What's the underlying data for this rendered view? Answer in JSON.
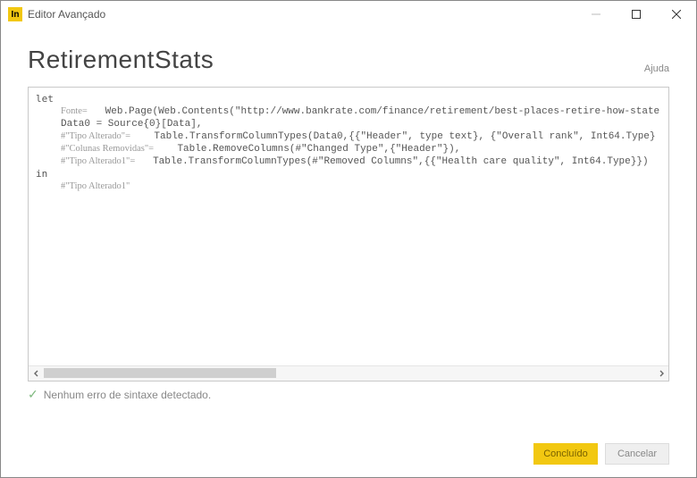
{
  "window": {
    "title": "Editor Avançado",
    "icon_text": "In"
  },
  "header": {
    "title": "RetirementStats",
    "help": "Ajuda"
  },
  "code": {
    "let": "let",
    "in": "in",
    "line1_label": "Fonte",
    "line1_code": "Web.Page(Web.Contents(\"http://www.bankrate.com/finance/retirement/best-places-retire-how-state",
    "line2_code": "Data0 = Source{0}[Data],",
    "line3_label": "#\"Tipo Alterado\"",
    "line3_code": "Table.TransformColumnTypes(Data0,{{\"Header\", type text}, {\"Overall rank\", Int64.Type}",
    "line4_label": "#\"Colunas Removidas\"",
    "line4_code": "Table.RemoveColumns(#\"Changed Type\",{\"Header\"}),",
    "line5_label": "#\"Tipo Alterado1\"",
    "line5_code": "Table.TransformColumnTypes(#\"Removed Columns\",{{\"Health care quality\", Int64.Type}})",
    "result": "#\"Tipo Alterado1\""
  },
  "status": {
    "message": "Nenhum erro de sintaxe detectado."
  },
  "buttons": {
    "done": "Concluído",
    "cancel": "Cancelar"
  },
  "eq": " = "
}
